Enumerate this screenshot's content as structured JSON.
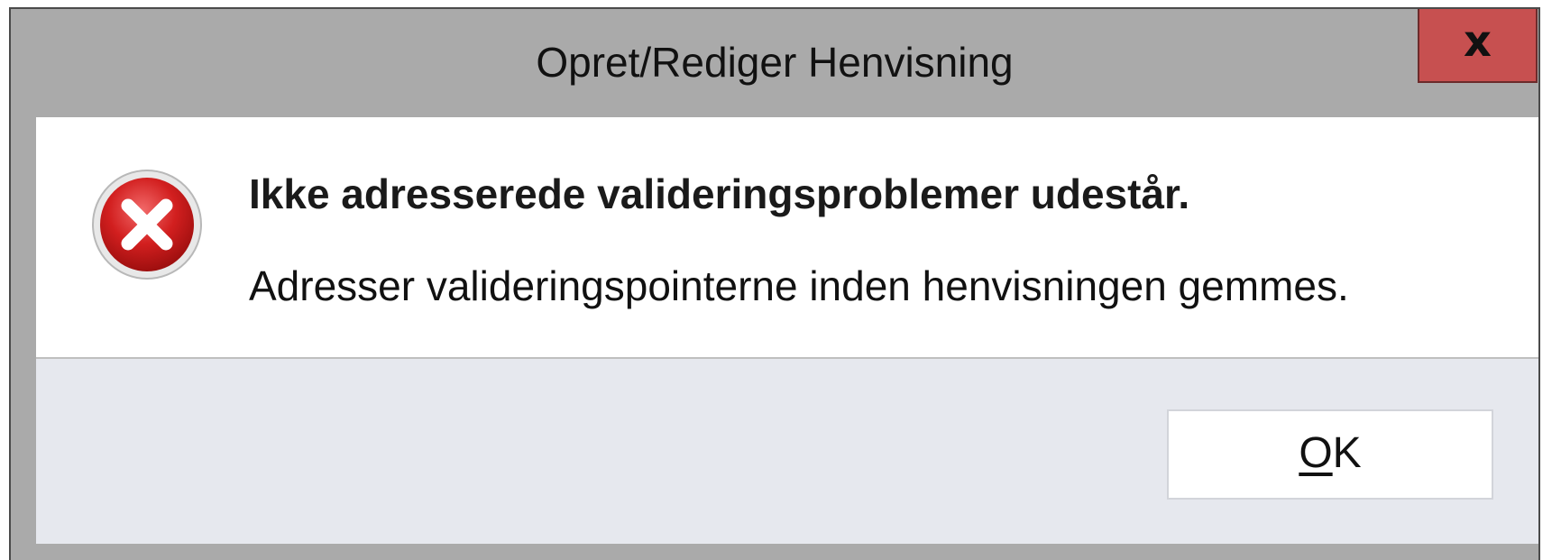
{
  "window": {
    "title": "Opret/Rediger Henvisning",
    "close_label": "x"
  },
  "message": {
    "icon": "error-icon",
    "heading": "Ikke adresserede valideringsproblemer udestår.",
    "detail": "Adresser valideringspointerne inden henvisningen gemmes."
  },
  "buttons": {
    "ok_mnemonic": "O",
    "ok_rest": "K"
  },
  "colors": {
    "close_button": "#c75050",
    "error_icon": "#d21f1f",
    "window_frame": "#aaaaaa",
    "button_panel": "#e6e8ee"
  }
}
